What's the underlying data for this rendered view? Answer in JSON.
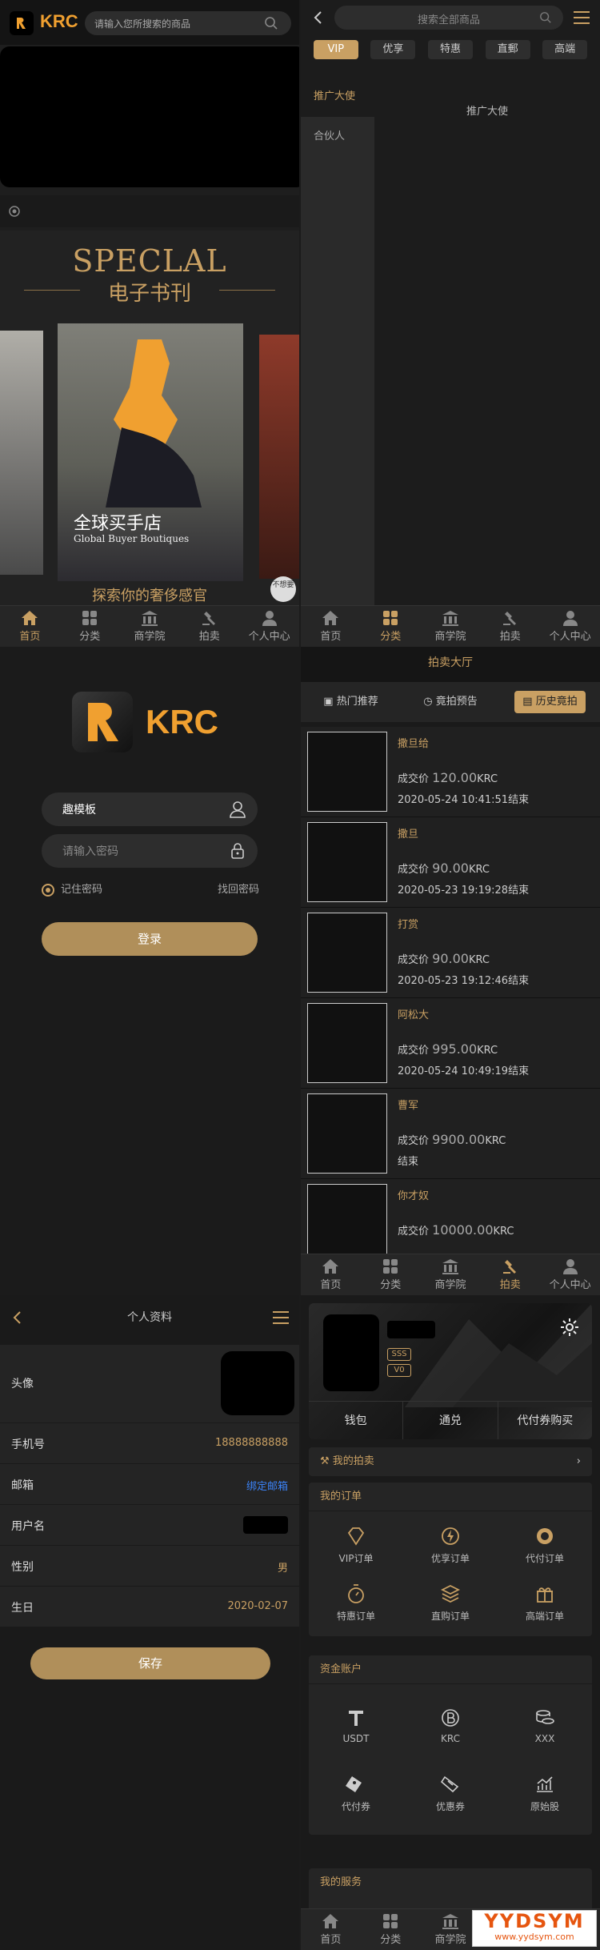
{
  "brand": {
    "logo_text": "KRC",
    "accent": "#c9a063",
    "logo_color": "#f0a030"
  },
  "tabbar": {
    "home": "首页",
    "category": "分类",
    "academy": "商学院",
    "auction": "拍卖",
    "user": "个人中心"
  },
  "home": {
    "search_placeholder": "请输入您所搜索的商品",
    "special_title": "SPECLAL",
    "special_sub": "电子书刊",
    "store_cn": "全球买手店",
    "store_en": "Global Buyer Boutiques",
    "explore": "探索你的奢侈感官",
    "float_label": "不想要"
  },
  "category": {
    "search_placeholder": "搜索全部商品",
    "tags": [
      "VIP",
      "优享",
      "特惠",
      "直郵",
      "高端"
    ],
    "side": [
      "推广大使",
      "合伙人"
    ],
    "content_title": "推广大使"
  },
  "login": {
    "username": "趣模板",
    "password_placeholder": "请输入密码",
    "remember": "记住密码",
    "forgot": "找回密码",
    "login_button": "登录"
  },
  "auction": {
    "title": "拍卖大厅",
    "tabs": [
      "热门推荐",
      "竟拍预告",
      "历史竟拍"
    ],
    "price_label": "成交价",
    "unit": "KRC",
    "items": [
      {
        "name": "撒旦给",
        "price": "120.00",
        "time": "2020-05-24 10:41:51结束"
      },
      {
        "name": "撒旦",
        "price": "90.00",
        "time": "2020-05-23 19:19:28结束"
      },
      {
        "name": "打赏",
        "price": "90.00",
        "time": "2020-05-23 19:12:46结束"
      },
      {
        "name": "阿松大",
        "price": "995.00",
        "time": "2020-05-24 10:49:19结束"
      },
      {
        "name": "曹军",
        "price": "9900.00",
        "time": "结束"
      },
      {
        "name": "你才奴",
        "price": "10000.00",
        "time": ""
      }
    ]
  },
  "profile": {
    "title": "个人资料",
    "avatar_label": "头像",
    "phone_label": "手机号",
    "phone": "18888888888",
    "email_label": "邮箱",
    "email_value": "绑定邮箱",
    "username_label": "用户名",
    "gender_label": "性别",
    "gender": "男",
    "birthday_label": "生日",
    "birthday": "2020-02-07",
    "save": "保存"
  },
  "user": {
    "badges": [
      "SSS",
      "V0"
    ],
    "links": [
      "钱包",
      "通兑",
      "代付券购买"
    ],
    "my_auction": "我的拍卖",
    "orders_title": "我的订单",
    "orders": [
      "VIP订单",
      "优享订单",
      "代付订单",
      "特惠订单",
      "直购订单",
      "高端订单"
    ],
    "assets_title": "资金账户",
    "assets": [
      "USDT",
      "KRC",
      "XXX",
      "代付券",
      "优惠券",
      "原始股"
    ],
    "services_title": "我的服务"
  },
  "watermark": {
    "line1": "YYDSYM",
    "line2": "www.yydsym.com"
  }
}
